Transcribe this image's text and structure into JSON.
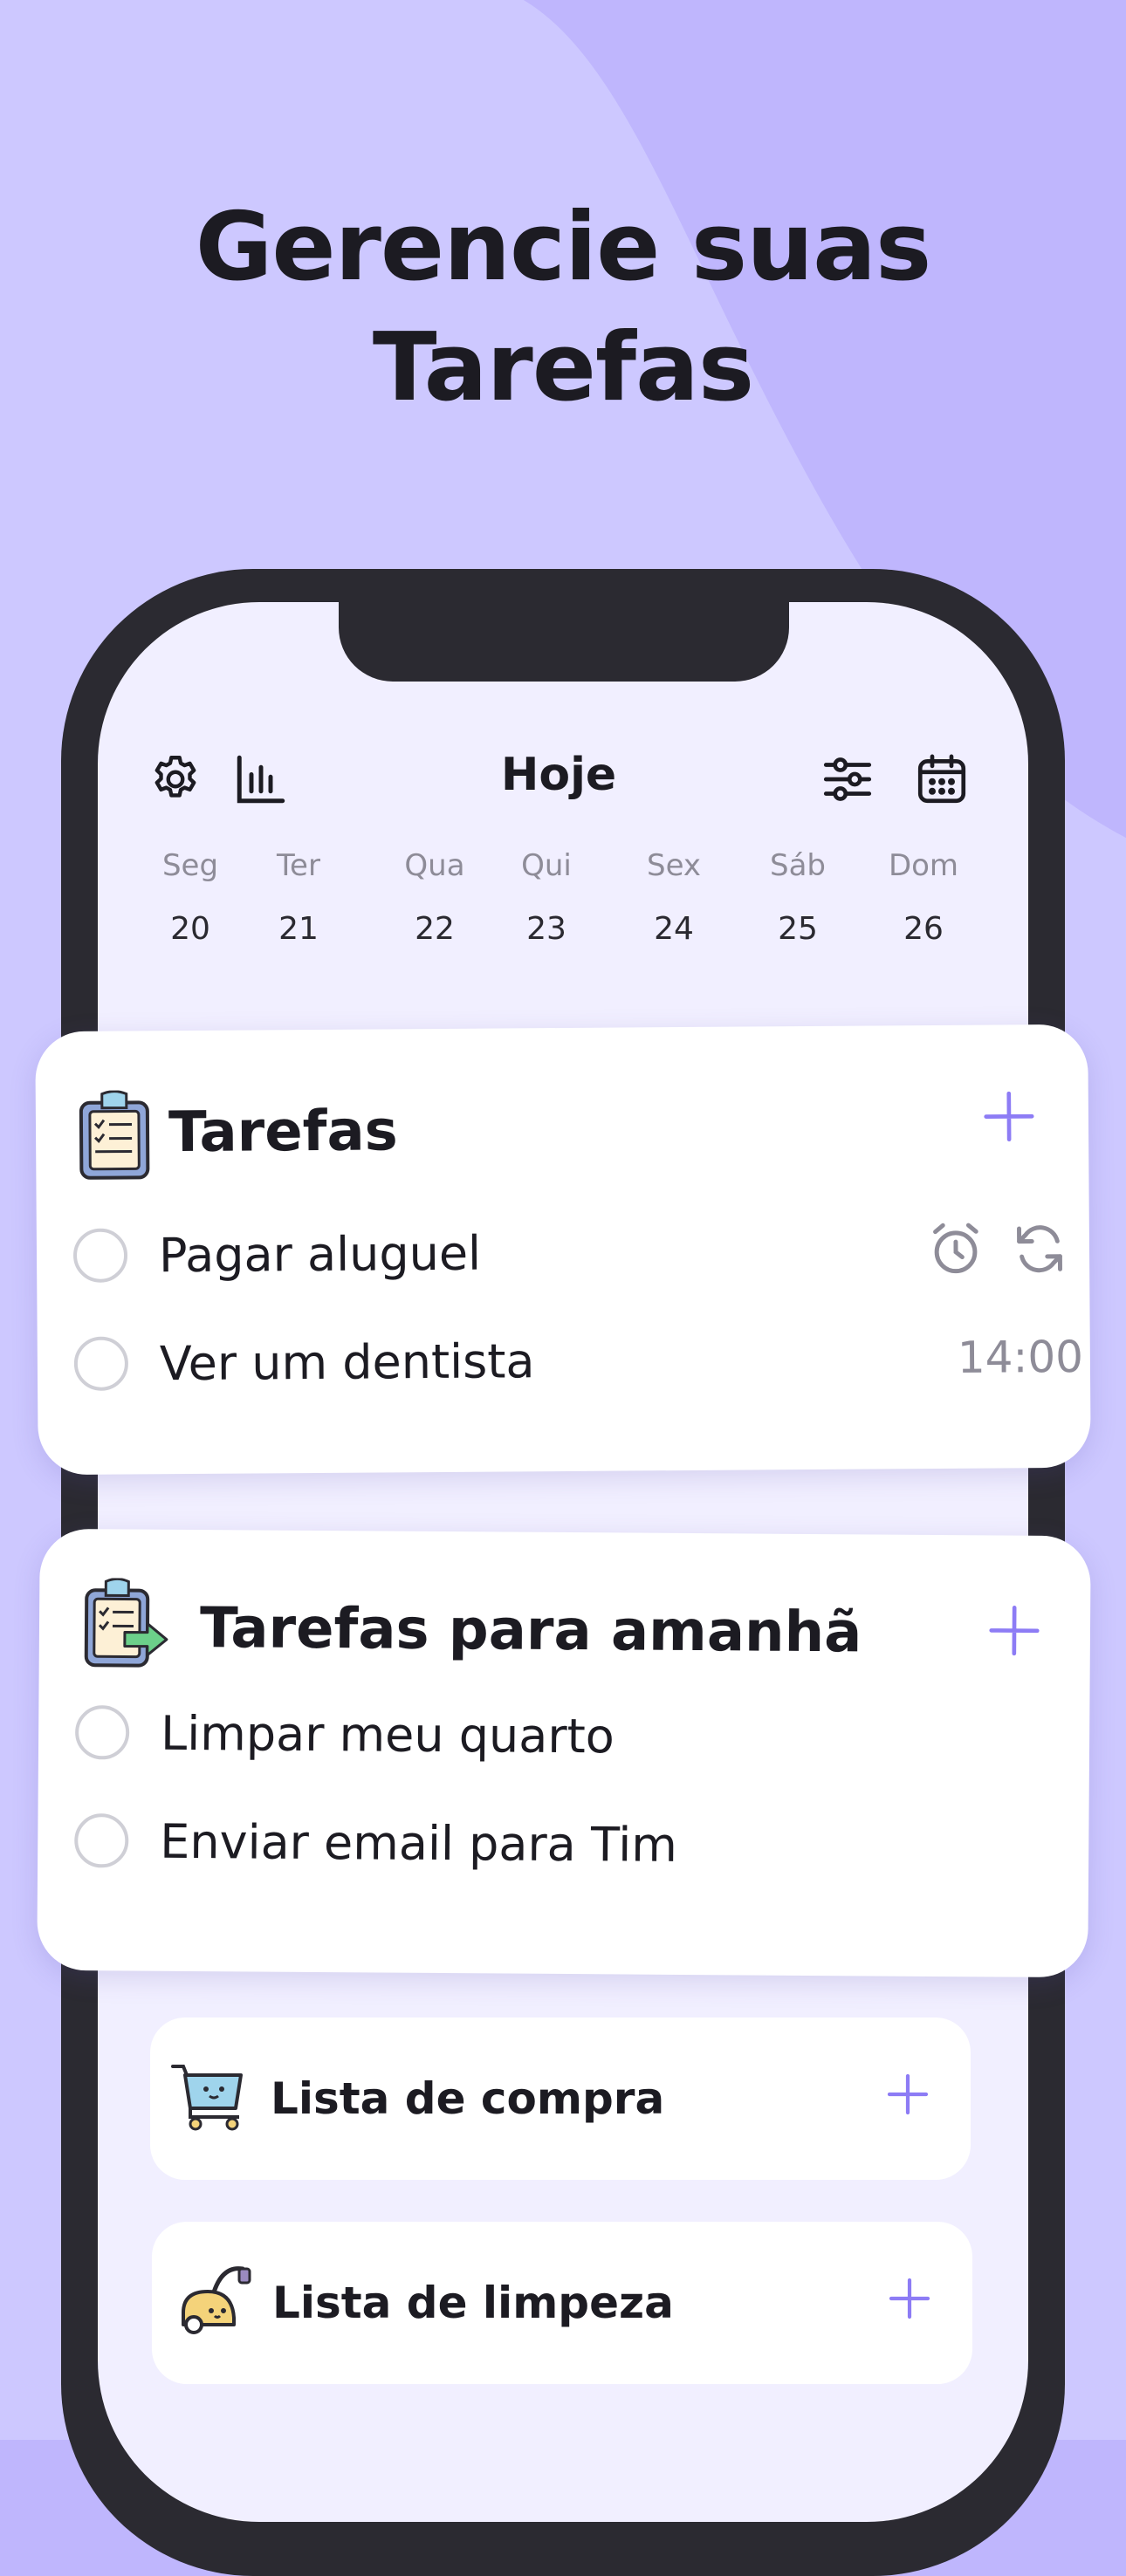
{
  "headline": {
    "line1": "Gerencie suas",
    "line2": "Tarefas"
  },
  "colors": {
    "background": "#bfb6fd",
    "background_light": "#cdc8ff",
    "accent": "#8d7cf5",
    "phone_frame": "#2b2a31",
    "screen": "#f1efff",
    "muted_text": "#8e8c98"
  },
  "top_bar": {
    "title": "Hoje",
    "left_icons": [
      "gear-icon",
      "stats-bars-icon"
    ],
    "right_icons": [
      "filter-sliders-icon",
      "calendar-icon"
    ]
  },
  "week": [
    {
      "name": "Seg",
      "num": "20"
    },
    {
      "name": "Ter",
      "num": "21"
    },
    {
      "name": "Qua",
      "num": "22"
    },
    {
      "name": "Qui",
      "num": "23"
    },
    {
      "name": "Sex",
      "num": "24"
    },
    {
      "name": "Sáb",
      "num": "25"
    },
    {
      "name": "Dom",
      "num": "26"
    }
  ],
  "today_card": {
    "title": "Tarefas",
    "icon": "clipboard-checklist-icon",
    "tasks": [
      {
        "label": "Pagar aluguel",
        "meta_icons": [
          "alarm-clock-icon",
          "repeat-icon"
        ]
      },
      {
        "label": "Ver um dentista",
        "time": "14:00"
      }
    ]
  },
  "tomorrow_card": {
    "title": "Tarefas para amanhã",
    "icon": "clipboard-arrow-icon",
    "tasks": [
      {
        "label": "Limpar meu quarto"
      },
      {
        "label": "Enviar email para Tim"
      }
    ]
  },
  "lists": [
    {
      "title": "Lista de compra",
      "icon": "shopping-cart-icon"
    },
    {
      "title": "Lista de limpeza",
      "icon": "vacuum-cleaner-icon"
    }
  ]
}
